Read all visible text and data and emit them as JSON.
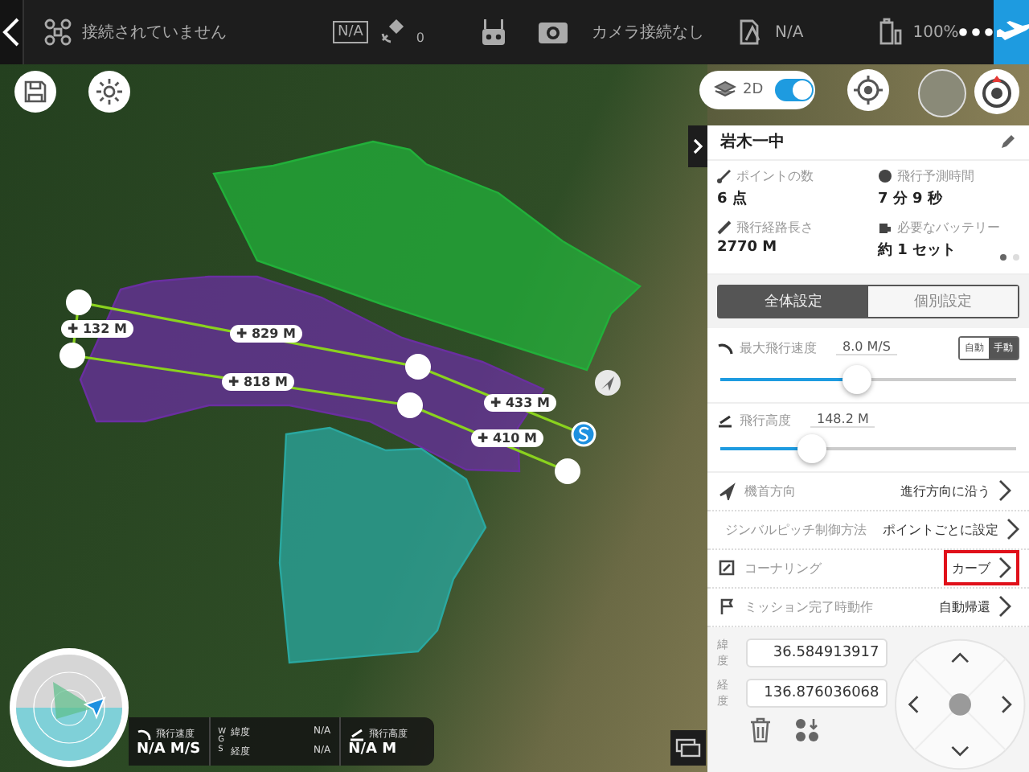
{
  "top_bar": {
    "connection_status": "接続されていません",
    "rc_badge": "N/A",
    "satellite_count": "0",
    "camera_status": "カメラ接続なし",
    "vision_status": "N/A",
    "battery": "100%"
  },
  "map": {
    "mode_label": "2D",
    "mode_toggle_on": true,
    "areas": [
      {
        "color": "#22b03a"
      },
      {
        "color": "#6a2fa0"
      },
      {
        "color": "#2aa8a0"
      }
    ],
    "segments": [
      {
        "label": "✚ 132 M"
      },
      {
        "label": "✚ 829 M"
      },
      {
        "label": "✚ 818 M"
      },
      {
        "label": "✚ 433 M"
      },
      {
        "label": "✚ 410 M"
      }
    ]
  },
  "telemetry": {
    "speed_label": "飛行速度",
    "speed": "N/A M/S",
    "datum": "WGS",
    "latitude_label": "緯度",
    "latitude": "N/A",
    "longitude_label": "経度",
    "longitude": "N/A",
    "altitude_label": "飛行高度",
    "altitude": "N/A M"
  },
  "panel": {
    "title": "岩木一中",
    "stats": [
      {
        "kind": "points",
        "label": "ポイントの数",
        "value": "6 点"
      },
      {
        "kind": "time",
        "label": "飛行予測時間",
        "value": "7 分 9 秒"
      },
      {
        "kind": "length",
        "label": "飛行経路長さ",
        "value": "2770 M"
      },
      {
        "kind": "battery",
        "label": "必要なバッテリー",
        "value": "約 1 セット"
      }
    ],
    "pages": [
      {
        "selected": true
      },
      {
        "selected": false
      }
    ],
    "tabs": [
      {
        "label": "全体設定",
        "selected": true
      },
      {
        "label": "個別設定",
        "selected": false
      }
    ],
    "speed": {
      "label": "最大飛行速度",
      "value": "8.0 M/S",
      "level": 0.46,
      "modes": [
        {
          "label": "自動",
          "selected": false
        },
        {
          "label": "手動",
          "selected": true
        }
      ]
    },
    "altitude": {
      "label": "飛行高度",
      "value": "148.2 M",
      "level": 0.31
    },
    "settings": [
      {
        "kind": "heading",
        "label": "機首方向",
        "value": "進行方向に沿う",
        "highlighted": false
      },
      {
        "kind": "gimbal",
        "label": "ジンバルピッチ制御方法",
        "value": "ポイントごとに設定",
        "highlighted": false
      },
      {
        "kind": "corner",
        "label": "コーナリング",
        "value": "カーブ",
        "highlighted": true
      },
      {
        "kind": "finish",
        "label": "ミッション完了時動作",
        "value": "自動帰還",
        "highlighted": false
      }
    ],
    "coordinates": {
      "latitude_label": "緯度",
      "latitude": "36.584913917",
      "longitude_label": "経度",
      "longitude": "136.876036068"
    }
  }
}
